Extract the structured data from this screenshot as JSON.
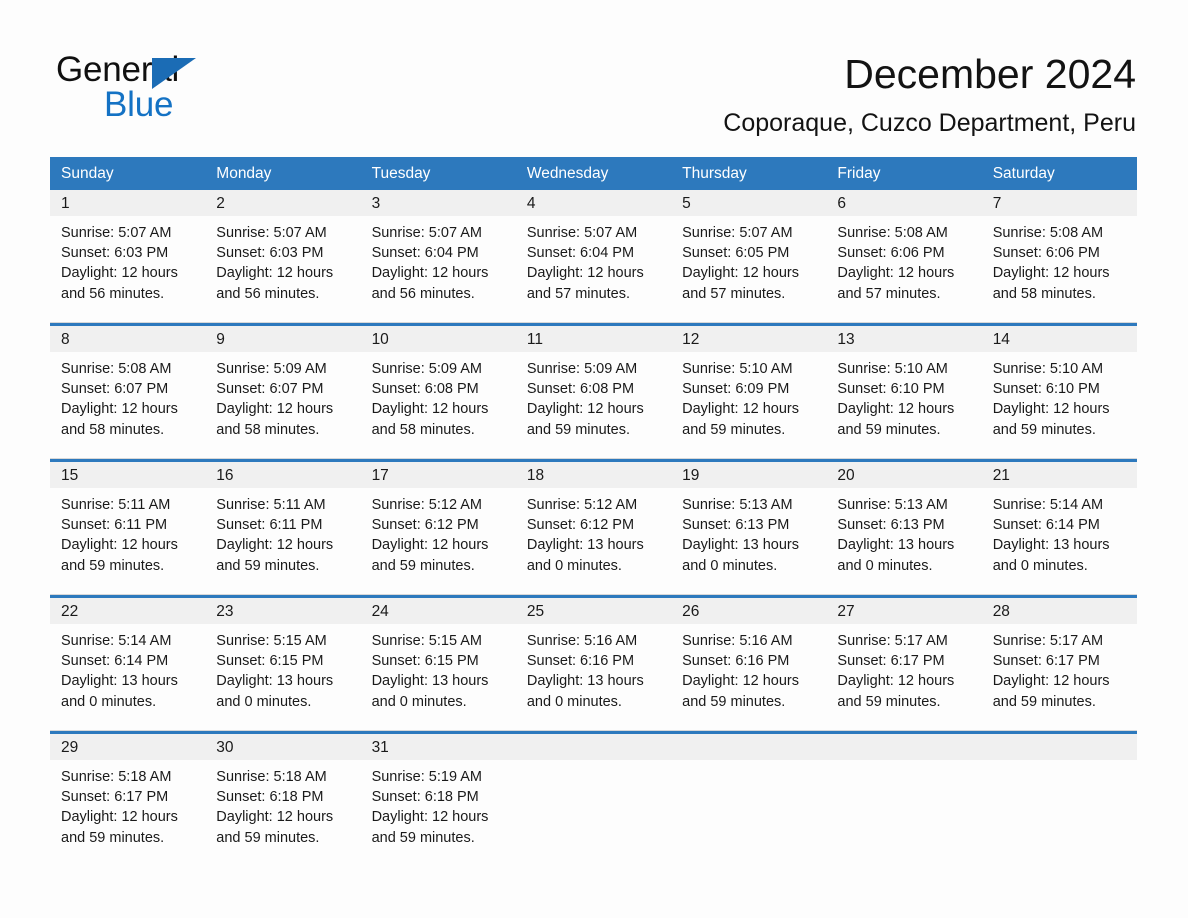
{
  "brand": {
    "name_part1": "General",
    "name_part2": "Blue",
    "flag_icon": "triangle-flag-icon",
    "accent_color": "#1472c4"
  },
  "header": {
    "title": "December 2024",
    "subtitle": "Coporaque, Cuzco Department, Peru"
  },
  "calendar": {
    "header_bg": "#2d79bd",
    "date_band_bg": "#f0f0f0",
    "weekdays": [
      "Sunday",
      "Monday",
      "Tuesday",
      "Wednesday",
      "Thursday",
      "Friday",
      "Saturday"
    ],
    "weeks": [
      {
        "days": [
          {
            "date": "1",
            "sunrise": "Sunrise: 5:07 AM",
            "sunset": "Sunset: 6:03 PM",
            "daylight": "Daylight: 12 hours and 56 minutes."
          },
          {
            "date": "2",
            "sunrise": "Sunrise: 5:07 AM",
            "sunset": "Sunset: 6:03 PM",
            "daylight": "Daylight: 12 hours and 56 minutes."
          },
          {
            "date": "3",
            "sunrise": "Sunrise: 5:07 AM",
            "sunset": "Sunset: 6:04 PM",
            "daylight": "Daylight: 12 hours and 56 minutes."
          },
          {
            "date": "4",
            "sunrise": "Sunrise: 5:07 AM",
            "sunset": "Sunset: 6:04 PM",
            "daylight": "Daylight: 12 hours and 57 minutes."
          },
          {
            "date": "5",
            "sunrise": "Sunrise: 5:07 AM",
            "sunset": "Sunset: 6:05 PM",
            "daylight": "Daylight: 12 hours and 57 minutes."
          },
          {
            "date": "6",
            "sunrise": "Sunrise: 5:08 AM",
            "sunset": "Sunset: 6:06 PM",
            "daylight": "Daylight: 12 hours and 57 minutes."
          },
          {
            "date": "7",
            "sunrise": "Sunrise: 5:08 AM",
            "sunset": "Sunset: 6:06 PM",
            "daylight": "Daylight: 12 hours and 58 minutes."
          }
        ]
      },
      {
        "days": [
          {
            "date": "8",
            "sunrise": "Sunrise: 5:08 AM",
            "sunset": "Sunset: 6:07 PM",
            "daylight": "Daylight: 12 hours and 58 minutes."
          },
          {
            "date": "9",
            "sunrise": "Sunrise: 5:09 AM",
            "sunset": "Sunset: 6:07 PM",
            "daylight": "Daylight: 12 hours and 58 minutes."
          },
          {
            "date": "10",
            "sunrise": "Sunrise: 5:09 AM",
            "sunset": "Sunset: 6:08 PM",
            "daylight": "Daylight: 12 hours and 58 minutes."
          },
          {
            "date": "11",
            "sunrise": "Sunrise: 5:09 AM",
            "sunset": "Sunset: 6:08 PM",
            "daylight": "Daylight: 12 hours and 59 minutes."
          },
          {
            "date": "12",
            "sunrise": "Sunrise: 5:10 AM",
            "sunset": "Sunset: 6:09 PM",
            "daylight": "Daylight: 12 hours and 59 minutes."
          },
          {
            "date": "13",
            "sunrise": "Sunrise: 5:10 AM",
            "sunset": "Sunset: 6:10 PM",
            "daylight": "Daylight: 12 hours and 59 minutes."
          },
          {
            "date": "14",
            "sunrise": "Sunrise: 5:10 AM",
            "sunset": "Sunset: 6:10 PM",
            "daylight": "Daylight: 12 hours and 59 minutes."
          }
        ]
      },
      {
        "days": [
          {
            "date": "15",
            "sunrise": "Sunrise: 5:11 AM",
            "sunset": "Sunset: 6:11 PM",
            "daylight": "Daylight: 12 hours and 59 minutes."
          },
          {
            "date": "16",
            "sunrise": "Sunrise: 5:11 AM",
            "sunset": "Sunset: 6:11 PM",
            "daylight": "Daylight: 12 hours and 59 minutes."
          },
          {
            "date": "17",
            "sunrise": "Sunrise: 5:12 AM",
            "sunset": "Sunset: 6:12 PM",
            "daylight": "Daylight: 12 hours and 59 minutes."
          },
          {
            "date": "18",
            "sunrise": "Sunrise: 5:12 AM",
            "sunset": "Sunset: 6:12 PM",
            "daylight": "Daylight: 13 hours and 0 minutes."
          },
          {
            "date": "19",
            "sunrise": "Sunrise: 5:13 AM",
            "sunset": "Sunset: 6:13 PM",
            "daylight": "Daylight: 13 hours and 0 minutes."
          },
          {
            "date": "20",
            "sunrise": "Sunrise: 5:13 AM",
            "sunset": "Sunset: 6:13 PM",
            "daylight": "Daylight: 13 hours and 0 minutes."
          },
          {
            "date": "21",
            "sunrise": "Sunrise: 5:14 AM",
            "sunset": "Sunset: 6:14 PM",
            "daylight": "Daylight: 13 hours and 0 minutes."
          }
        ]
      },
      {
        "days": [
          {
            "date": "22",
            "sunrise": "Sunrise: 5:14 AM",
            "sunset": "Sunset: 6:14 PM",
            "daylight": "Daylight: 13 hours and 0 minutes."
          },
          {
            "date": "23",
            "sunrise": "Sunrise: 5:15 AM",
            "sunset": "Sunset: 6:15 PM",
            "daylight": "Daylight: 13 hours and 0 minutes."
          },
          {
            "date": "24",
            "sunrise": "Sunrise: 5:15 AM",
            "sunset": "Sunset: 6:15 PM",
            "daylight": "Daylight: 13 hours and 0 minutes."
          },
          {
            "date": "25",
            "sunrise": "Sunrise: 5:16 AM",
            "sunset": "Sunset: 6:16 PM",
            "daylight": "Daylight: 13 hours and 0 minutes."
          },
          {
            "date": "26",
            "sunrise": "Sunrise: 5:16 AM",
            "sunset": "Sunset: 6:16 PM",
            "daylight": "Daylight: 12 hours and 59 minutes."
          },
          {
            "date": "27",
            "sunrise": "Sunrise: 5:17 AM",
            "sunset": "Sunset: 6:17 PM",
            "daylight": "Daylight: 12 hours and 59 minutes."
          },
          {
            "date": "28",
            "sunrise": "Sunrise: 5:17 AM",
            "sunset": "Sunset: 6:17 PM",
            "daylight": "Daylight: 12 hours and 59 minutes."
          }
        ]
      },
      {
        "days": [
          {
            "date": "29",
            "sunrise": "Sunrise: 5:18 AM",
            "sunset": "Sunset: 6:17 PM",
            "daylight": "Daylight: 12 hours and 59 minutes."
          },
          {
            "date": "30",
            "sunrise": "Sunrise: 5:18 AM",
            "sunset": "Sunset: 6:18 PM",
            "daylight": "Daylight: 12 hours and 59 minutes."
          },
          {
            "date": "31",
            "sunrise": "Sunrise: 5:19 AM",
            "sunset": "Sunset: 6:18 PM",
            "daylight": "Daylight: 12 hours and 59 minutes."
          },
          {
            "date": "",
            "sunrise": "",
            "sunset": "",
            "daylight": ""
          },
          {
            "date": "",
            "sunrise": "",
            "sunset": "",
            "daylight": ""
          },
          {
            "date": "",
            "sunrise": "",
            "sunset": "",
            "daylight": ""
          },
          {
            "date": "",
            "sunrise": "",
            "sunset": "",
            "daylight": ""
          }
        ]
      }
    ]
  }
}
